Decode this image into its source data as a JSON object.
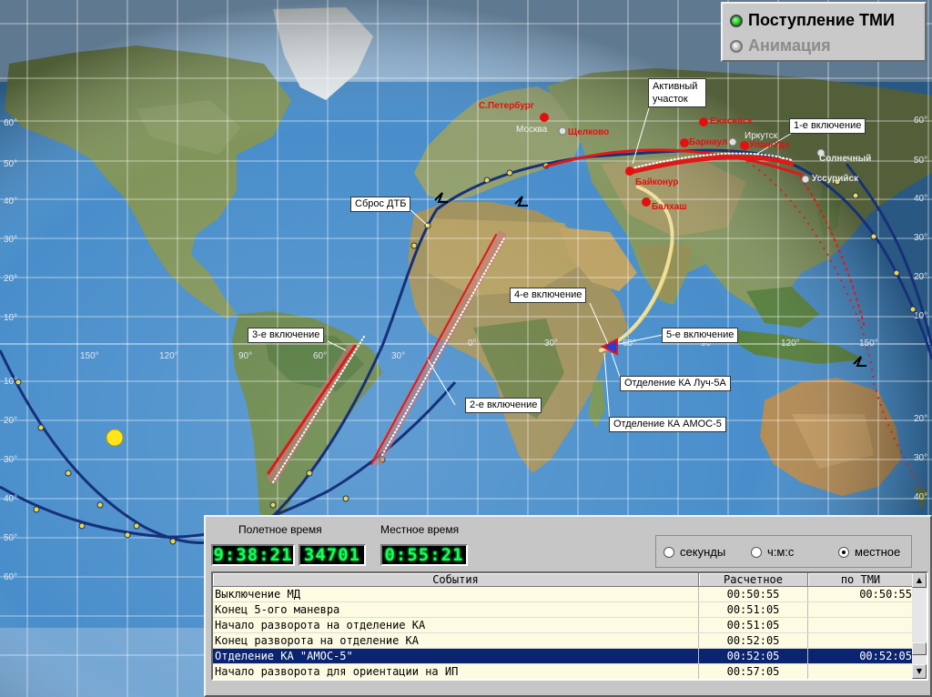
{
  "colors": {
    "ocean": "#3f88c8",
    "land": "#6f8e4a",
    "track_blue": "#16307a",
    "burn_red": "#e01818",
    "city_red": "#e41010",
    "city_gray": "#bdbdbd",
    "sun_yellow": "#ffe51a",
    "spacecraft_blue": "#2a3ad8",
    "lcd_green": "#19ff4a",
    "selected_row": "#0a2470"
  },
  "grid": {
    "lat_labels": [
      "60°",
      "50°",
      "40°",
      "30°",
      "20°",
      "10°",
      "10°",
      "20°",
      "30°",
      "40°",
      "50°",
      "60°"
    ],
    "lon_labels": [
      "150°",
      "120°",
      "90°",
      "60°",
      "30°",
      "0°",
      "30°",
      "60°",
      "90°",
      "120°",
      "150°"
    ],
    "right_lat_labels": [
      "60°",
      "50°",
      "40°",
      "30°",
      "20°",
      "10°",
      "20°",
      "30°",
      "40°"
    ]
  },
  "cities": [
    {
      "name": "С.Петербург",
      "color": "red"
    },
    {
      "name": "Москва",
      "color": "white"
    },
    {
      "name": "Щелково",
      "color": "red"
    },
    {
      "name": "Енисейск",
      "color": "red"
    },
    {
      "name": "Иркутск",
      "color": "white"
    },
    {
      "name": "Барнаул",
      "color": "red"
    },
    {
      "name": "Улан-Удэ",
      "color": "red"
    },
    {
      "name": "Солнечный",
      "color": "white"
    },
    {
      "name": "Уссурийск",
      "color": "white"
    },
    {
      "name": "Байконур",
      "color": "red"
    },
    {
      "name": "Балхаш",
      "color": "red"
    }
  ],
  "callouts": {
    "active_section": "Активный участок",
    "burn1": "1-е включение",
    "dtb_drop": "Сброс ДТБ",
    "burn3": "3-е включение",
    "burn2": "2-е включение",
    "burn4": "4-е включение",
    "burn5": "5-е включение",
    "sep_luch": "Отделение КА Луч-5А",
    "sep_amos": "Отделение КА АМОС-5"
  },
  "status": {
    "tmi": {
      "label": "Поступление ТМИ",
      "icon": "green-led-icon"
    },
    "anim": {
      "label": "Анимация",
      "icon": "gray-led-icon"
    }
  },
  "panel": {
    "flight_time_caption": "Полетное время",
    "local_time_caption": "Местное время",
    "flight_time": "9:38:21",
    "flight_seconds": "34701",
    "local_time": "0:55:21",
    "modes": [
      {
        "label": "секунды",
        "selected": false
      },
      {
        "label": "ч:м:с",
        "selected": false
      },
      {
        "label": "местное",
        "selected": true
      }
    ]
  },
  "events_table": {
    "headers": [
      "События",
      "Расчетное",
      "по ТМИ"
    ],
    "rows": [
      {
        "event": "Выключение МД",
        "calc": "00:50:55",
        "tmi": "00:50:55",
        "selected": false
      },
      {
        "event": "Конец 5-ого маневра",
        "calc": "00:51:05",
        "tmi": "",
        "selected": false
      },
      {
        "event": "Начало разворота на отделение КА",
        "calc": "00:51:05",
        "tmi": "",
        "selected": false
      },
      {
        "event": "Конец разворота на отделение КА",
        "calc": "00:52:05",
        "tmi": "",
        "selected": false
      },
      {
        "event": "Отделение КА \"АМОС-5\"",
        "calc": "00:52:05",
        "tmi": "00:52:05",
        "selected": true
      },
      {
        "event": "Начало разворота для ориентации на ИП",
        "calc": "00:57:05",
        "tmi": "",
        "selected": false
      }
    ]
  }
}
